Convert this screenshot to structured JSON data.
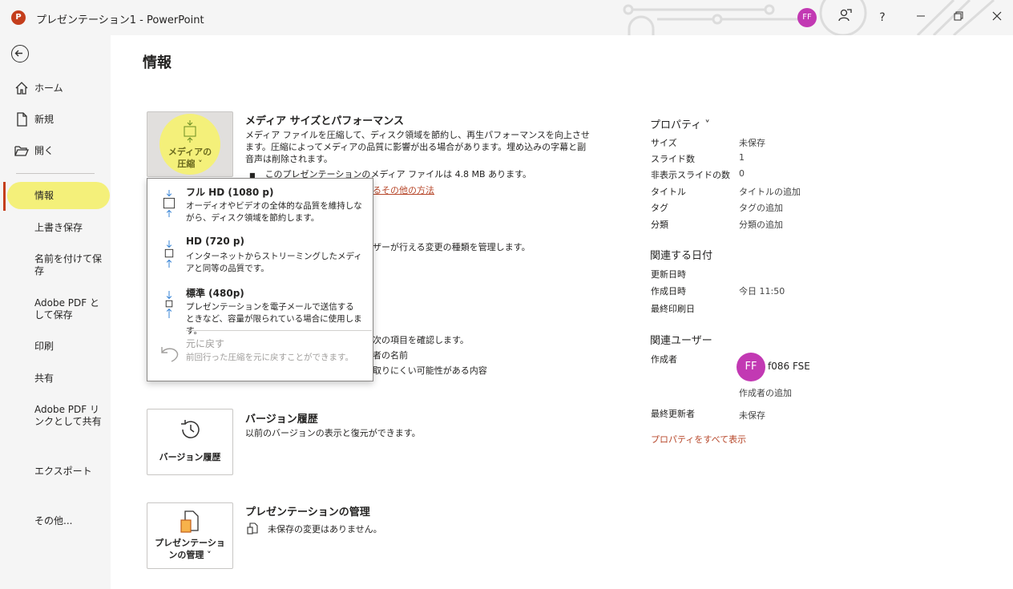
{
  "window": {
    "app_logo": "P",
    "title": "プレゼンテーション1 - PowerPoint",
    "avatar_initials": "FF",
    "help_label": "?"
  },
  "sidebar": {
    "items": [
      {
        "label": "ホーム",
        "icon": "home-icon"
      },
      {
        "label": "新規",
        "icon": "new-document-icon"
      },
      {
        "label": "開く",
        "icon": "open-folder-icon"
      },
      {
        "label": "情報"
      },
      {
        "label": "上書き保存"
      },
      {
        "label": "名前を付けて保存"
      },
      {
        "label": "Adobe PDF として保存"
      },
      {
        "label": "印刷"
      },
      {
        "label": "共有"
      },
      {
        "label": "Adobe PDF リンクとして共有"
      },
      {
        "label": "エクスポート"
      },
      {
        "label": "その他..."
      }
    ]
  },
  "main": {
    "title": "情報",
    "media": {
      "tile_label_line1": "メディアの",
      "tile_label_line2": "圧縮 ˅",
      "heading": "メディア サイズとパフォーマンス",
      "description": "メディア ファイルを圧縮して、ディスク領域を節約し、再生パフォーマンスを向上させます。圧縮によってメディアの品質に影響が出る場合があります。埋め込みの字幕と副音声は削除されます。",
      "bullet": "このプレゼンテーションのメディア ファイルは 4.8 MB あります。",
      "link": "るその他の方法"
    },
    "protect": {
      "partial_text": "ザーが行える変更の種類を管理します。"
    },
    "inspect": {
      "partial_line1": "次の項目を確認します。",
      "partial_line2": "者の名前",
      "partial_line3": "取りにくい可能性がある内容"
    },
    "version": {
      "tile_label": "バージョン履歴",
      "heading": "バージョン履歴",
      "description": "以前のバージョンの表示と復元ができます。"
    },
    "manage": {
      "tile_label_line1": "プレゼンテーショ",
      "tile_label_line2": "ンの管理 ˅",
      "heading": "プレゼンテーションの管理",
      "status": "未保存の変更はありません。"
    }
  },
  "dropdown": {
    "items": [
      {
        "title": "フル HD (1080 p)",
        "desc": "オーディオやビデオの全体的な品質を維持しながら、ディスク領域を節約します。"
      },
      {
        "title": "HD (720 p)",
        "desc": "インターネットからストリーミングしたメディアと同等の品質です。"
      },
      {
        "title": "標準 (480p)",
        "desc": "プレゼンテーションを電子メールで送信するときなど、容量が限られている場合に使用します。"
      },
      {
        "title": "元に戻す",
        "desc": "前回行った圧縮を元に戻すことができます。"
      }
    ]
  },
  "properties": {
    "heading": "プロパティ ˅",
    "rows": [
      {
        "key": "サイズ",
        "value": "未保存"
      },
      {
        "key": "スライド数",
        "value": "1"
      },
      {
        "key": "非表示スライドの数",
        "value": "0"
      },
      {
        "key": "タイトル",
        "value": "タイトルの追加"
      },
      {
        "key": "タグ",
        "value": "タグの追加"
      },
      {
        "key": "分類",
        "value": "分類の追加"
      }
    ],
    "dates_heading": "関連する日付",
    "dates": [
      {
        "key": "更新日時",
        "value": ""
      },
      {
        "key": "作成日時",
        "value": "今日 11:50"
      },
      {
        "key": "最終印刷日",
        "value": ""
      }
    ],
    "people_heading": "関連ユーザー",
    "author_key": "作成者",
    "author_initials": "FF",
    "author_name": "f086 FSE",
    "add_author": "作成者の追加",
    "last_modified_key": "最終更新者",
    "last_modified_value": "未保存",
    "show_all": "プロパティをすべて表示"
  },
  "colors": {
    "accent": "#c43e1c",
    "highlight": "#f4f07a",
    "avatar": "#c239b3",
    "link": "#b7472a"
  }
}
